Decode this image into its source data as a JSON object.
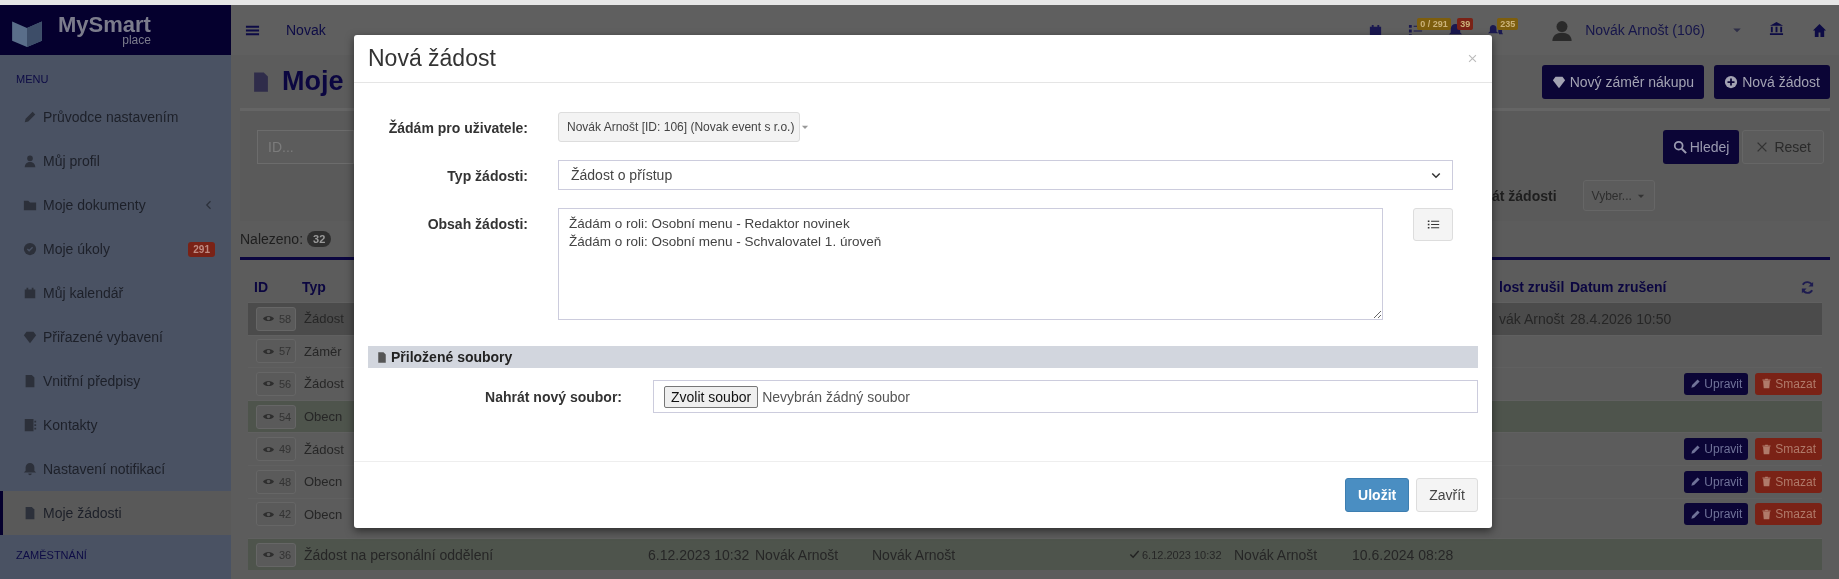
{
  "sidebar": {
    "logo": {
      "title": "MySmart",
      "subtitle": "place"
    },
    "section": "MENU",
    "next_section": "ZAMĚSTNÁNÍ",
    "items": [
      {
        "label": "Průvodce nastavením",
        "selected": false
      },
      {
        "label": "Můj profil",
        "selected": false
      },
      {
        "label": "Moje dokumenty",
        "selected": false,
        "expanded": false
      },
      {
        "label": "Moje úkoly",
        "selected": false,
        "badge": "291",
        "color": "#7a2216"
      },
      {
        "label": "Můj kalendář",
        "selected": false
      },
      {
        "label": "Přiřazené vybavení",
        "selected": false
      },
      {
        "label": "Vnitřní předpisy",
        "selected": false
      },
      {
        "label": "Kontakty",
        "selected": false
      },
      {
        "label": "Nastavení notifikací",
        "selected": false
      },
      {
        "label": "Moje žádosti",
        "selected": true
      }
    ]
  },
  "topbar": {
    "breadcrumb": "Novak",
    "notifications": [
      {
        "badge": "0 / 291",
        "color": "#7d5e0e"
      },
      {
        "badge": "39",
        "color": "#7a2216"
      },
      {
        "badge": "235",
        "color": "#7d5e0e"
      }
    ],
    "user": "Novák Arnošt (106)"
  },
  "page": {
    "title": "Moje",
    "actions": [
      "Nový záměr nákupu",
      "Nová žádost"
    ]
  },
  "filter": {
    "id_placeholder": "ID...",
    "search": "Hledej",
    "reset": "Reset",
    "status_label": "át žádosti",
    "status_placeholder": "Vyber..."
  },
  "found": {
    "label": "Nalezeno:",
    "count": "32"
  },
  "table": {
    "columns_left": [
      "ID",
      "Typ"
    ],
    "columns_right": [
      "lost zrušil",
      "Datum zrušení"
    ],
    "rows": [
      {
        "kind": "covered",
        "id": "58",
        "type": "Žádost",
        "selected": true,
        "approved": false,
        "canceled_by": "vák Arnošt",
        "canceled_at": "28.4.2026 10:50"
      },
      {
        "kind": "covered",
        "id": "57",
        "type": "Záměr",
        "selected": false,
        "approved": false
      },
      {
        "kind": "covered",
        "id": "56",
        "type": "Žádost",
        "selected": false,
        "approved": false,
        "actions": [
          "Upravit",
          "Smazat"
        ]
      },
      {
        "kind": "covered",
        "id": "54",
        "type": "Obecn",
        "selected": false,
        "approved": true
      },
      {
        "kind": "covered",
        "id": "49",
        "type": "Žádost",
        "selected": false,
        "approved": false,
        "actions": [
          "Upravit",
          "Smazat"
        ]
      },
      {
        "kind": "covered",
        "id": "48",
        "type": "Obecn",
        "selected": false,
        "approved": false,
        "actions": [
          "Upravit",
          "Smazat"
        ]
      },
      {
        "kind": "covered",
        "id": "42",
        "type": "Obecn",
        "selected": false,
        "approved": false,
        "actions": [
          "Upravit",
          "Smazat"
        ]
      },
      {
        "kind": "full",
        "id": "36",
        "type": "Žádost na personální oddělení",
        "selected": false,
        "approved": true,
        "created": "6.12.2023 10:32",
        "author": "Novák Arnošt",
        "column_5": "Novák Arnošt",
        "approved_at": "6.12.2023 10:32",
        "canceled_by": "Novák Arnošt",
        "canceled_at": "10.6.2024 08:28"
      }
    ]
  },
  "modal": {
    "title": "Nová žádost",
    "fields": [
      {
        "kind": "dropdown",
        "label": "Žádám pro uživatele:",
        "value": "Novák Arnošt [ID: 106] (Novak event s r.o.)"
      },
      {
        "kind": "select",
        "label": "Typ žádosti:",
        "value": "Žádost o přístup"
      },
      {
        "kind": "textarea",
        "label": "Obsah žádosti:",
        "lines": [
          "Žádám o roli: Osobní menu - Redaktor novinek",
          "Žádám o roli: Osobní menu - Schvalovatel 1. úroveň"
        ]
      }
    ],
    "attachments": {
      "title": "Přiložené soubory",
      "label": "Nahrát nový soubor:",
      "button": "Zvolit soubor",
      "status": "Nevybrán žádný soubor"
    },
    "buttons": [
      {
        "label": "Uložit",
        "kind": "primary"
      },
      {
        "label": "Zavřít",
        "kind": "default"
      }
    ]
  }
}
